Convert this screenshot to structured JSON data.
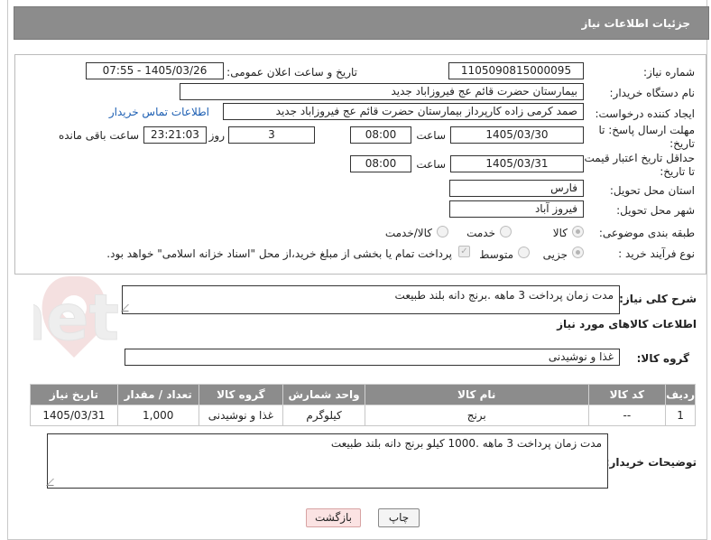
{
  "header": {
    "title": "جزئیات اطلاعات نیاز"
  },
  "form": {
    "need_number": {
      "label": "شماره نیاز:",
      "value": "1105090815000095"
    },
    "announce_datetime": {
      "label": "تاریخ و ساعت اعلان عمومی:",
      "value": "1405/03/26 - 07:55"
    },
    "buyer_org": {
      "label": "نام دستگاه خریدار:",
      "value": "بیمارستان حضرت قائم  عج  فیروزاباد جدید"
    },
    "requester": {
      "label": "ایجاد کننده درخواست:",
      "value": "صمد کرمی زاده کارپرداز بیمارستان حضرت قائم  عج  فیروزاباد جدید",
      "contact_link": "اطلاعات تماس خریدار"
    },
    "reply_deadline": {
      "label": "مهلت ارسال پاسخ: تا تاریخ:",
      "date": "1405/03/30",
      "time_label": "ساعت",
      "time": "08:00",
      "days": "3",
      "days_label": "روز و",
      "remaining": "23:21:03",
      "remaining_label": "ساعت باقی مانده"
    },
    "price_validity": {
      "label": "حداقل تاریخ اعتبار قیمت: تا تاریخ:",
      "date": "1405/03/31",
      "time_label": "ساعت",
      "time": "08:00"
    },
    "delivery_province": {
      "label": "استان محل تحویل:",
      "value": "فارس"
    },
    "delivery_city": {
      "label": "شهر محل تحویل:",
      "value": "فیروز آباد"
    },
    "category": {
      "label": "طبقه بندی موضوعی:",
      "options": [
        "کالا",
        "خدمت",
        "کالا/خدمت"
      ],
      "selected": "کالا"
    },
    "process_type": {
      "label": "نوع فرآیند خرید :",
      "options": [
        "جزیی",
        "متوسط"
      ],
      "selected": "جزیی",
      "payment_note": "پرداخت تمام یا بخشی از مبلغ خرید،از محل \"اسناد خزانه اسلامی\" خواهد بود."
    }
  },
  "description": {
    "label": "شرح کلی نیاز:",
    "value": "مدت زمان پرداخت 3 ماهه .برنج دانه بلند طبیعت"
  },
  "goods_section": {
    "title": "اطلاعات کالاهای مورد نیاز",
    "group_label": "گروه کالا:",
    "group_value": "غذا و نوشیدنی",
    "columns": [
      "ردیف",
      "کد کالا",
      "نام کالا",
      "واحد شمارش",
      "گروه کالا",
      "تعداد / مقدار",
      "تاریخ نیاز"
    ],
    "rows": [
      [
        "1",
        "--",
        "برنج",
        "کیلوگرم",
        "غذا و نوشیدنی",
        "1,000",
        "1405/03/31"
      ]
    ]
  },
  "buyer_notes": {
    "label": "توضیحات خریدار:",
    "value": "مدت زمان پرداخت 3 ماهه .1000 کیلو برنج دانه بلند طبیعت"
  },
  "buttons": {
    "print": "چاپ",
    "back": "بازگشت"
  },
  "colors": {
    "header_bg": "#8c8c8c",
    "link": "#1d5fb3",
    "back_button_bg": "#fbe3e3"
  }
}
